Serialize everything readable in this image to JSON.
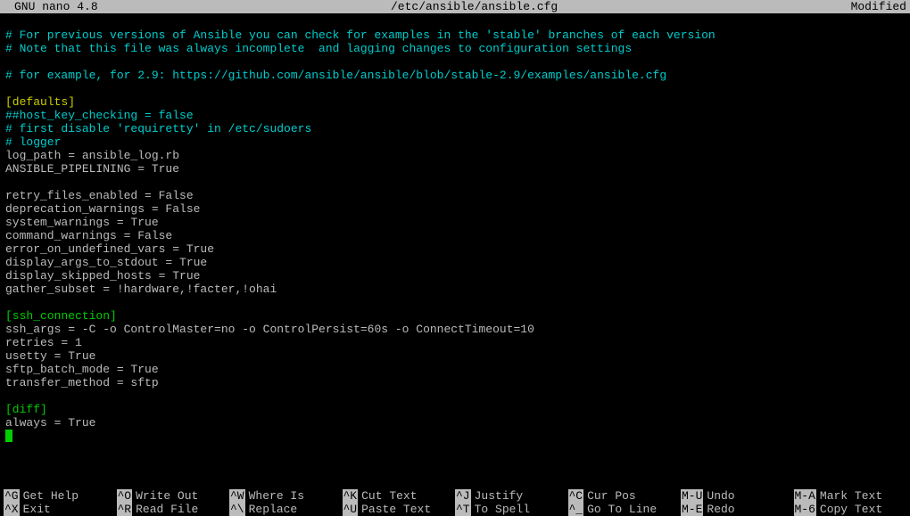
{
  "titlebar": {
    "app": "GNU nano 4.8",
    "file": "/etc/ansible/ansible.cfg",
    "status": "Modified"
  },
  "lines": [
    {
      "cls": "c-cyan",
      "t": "# For previous versions of Ansible you can check for examples in the 'stable' branches of each version"
    },
    {
      "cls": "c-cyan",
      "t": "# Note that this file was always incomplete  and lagging changes to configuration settings"
    },
    {
      "cls": "",
      "t": ""
    },
    {
      "cls": "c-cyan",
      "t": "# for example, for 2.9: https://github.com/ansible/ansible/blob/stable-2.9/examples/ansible.cfg"
    },
    {
      "cls": "",
      "t": ""
    },
    {
      "cls": "c-yellow",
      "t": "[defaults]"
    },
    {
      "cls": "c-cyan",
      "t": "##host_key_checking = false"
    },
    {
      "cls": "c-cyan",
      "t": "# first disable 'requiretty' in /etc/sudoers"
    },
    {
      "cls": "c-cyan",
      "t": "# logger"
    },
    {
      "cls": "c-white",
      "t": "log_path = ansible_log.rb"
    },
    {
      "cls": "c-white",
      "t": "ANSIBLE_PIPELINING = True"
    },
    {
      "cls": "",
      "t": ""
    },
    {
      "cls": "c-white",
      "t": "retry_files_enabled = False"
    },
    {
      "cls": "c-white",
      "t": "deprecation_warnings = False"
    },
    {
      "cls": "c-white",
      "t": "system_warnings = True"
    },
    {
      "cls": "c-white",
      "t": "command_warnings = False"
    },
    {
      "cls": "c-white",
      "t": "error_on_undefined_vars = True"
    },
    {
      "cls": "c-white",
      "t": "display_args_to_stdout = True"
    },
    {
      "cls": "c-white",
      "t": "display_skipped_hosts = True"
    },
    {
      "cls": "c-white",
      "t": "gather_subset = !hardware,!facter,!ohai"
    },
    {
      "cls": "",
      "t": ""
    },
    {
      "cls": "c-green",
      "t": "[ssh_connection]"
    },
    {
      "cls": "c-white",
      "t": "ssh_args = -C -o ControlMaster=no -o ControlPersist=60s -o ConnectTimeout=10"
    },
    {
      "cls": "c-white",
      "t": "retries = 1"
    },
    {
      "cls": "c-white",
      "t": "usetty = True"
    },
    {
      "cls": "c-white",
      "t": "sftp_batch_mode = True"
    },
    {
      "cls": "c-white",
      "t": "transfer_method = sftp"
    },
    {
      "cls": "",
      "t": ""
    },
    {
      "cls": "c-green",
      "t": "[diff]"
    },
    {
      "cls": "c-white",
      "t": "always = True"
    }
  ],
  "shortcuts": {
    "row1": [
      {
        "key": "^G",
        "label": "Get Help"
      },
      {
        "key": "^O",
        "label": "Write Out"
      },
      {
        "key": "^W",
        "label": "Where Is"
      },
      {
        "key": "^K",
        "label": "Cut Text"
      },
      {
        "key": "^J",
        "label": "Justify"
      },
      {
        "key": "^C",
        "label": "Cur Pos"
      },
      {
        "key": "M-U",
        "label": "Undo"
      },
      {
        "key": "M-A",
        "label": "Mark Text"
      }
    ],
    "row2": [
      {
        "key": "^X",
        "label": "Exit"
      },
      {
        "key": "^R",
        "label": "Read File"
      },
      {
        "key": "^\\",
        "label": "Replace"
      },
      {
        "key": "^U",
        "label": "Paste Text"
      },
      {
        "key": "^T",
        "label": "To Spell"
      },
      {
        "key": "^_",
        "label": "Go To Line"
      },
      {
        "key": "M-E",
        "label": "Redo"
      },
      {
        "key": "M-6",
        "label": "Copy Text"
      }
    ]
  }
}
